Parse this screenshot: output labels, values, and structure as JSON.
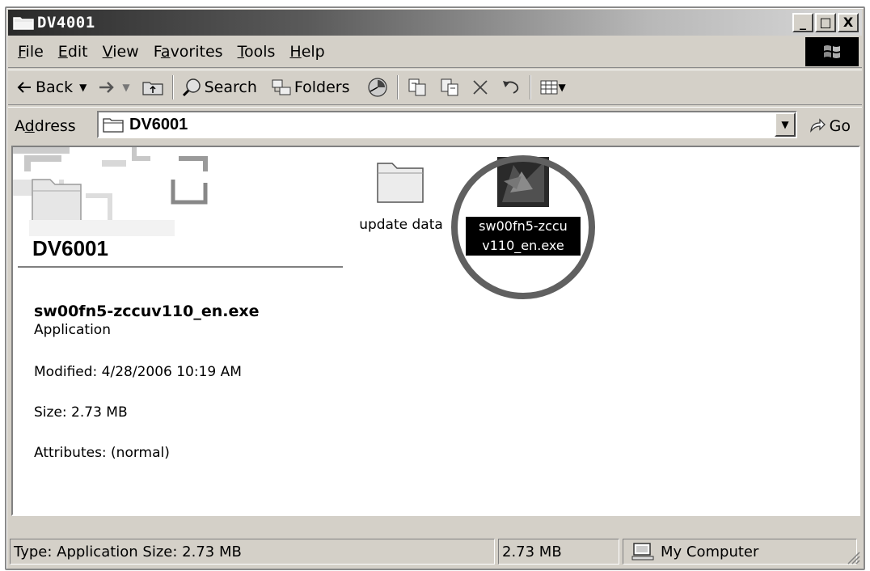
{
  "window": {
    "title": "DV4001",
    "minimize": "_",
    "maximize": "□",
    "close": "X"
  },
  "menu": {
    "items": [
      {
        "label": "File",
        "key": "F",
        "rest": "ile"
      },
      {
        "label": "Edit",
        "key": "E",
        "rest": "dit"
      },
      {
        "label": "View",
        "key": "V",
        "rest": "iew"
      },
      {
        "label": "Favorites",
        "pre": "F",
        "key": "a",
        "rest": "vorites"
      },
      {
        "label": "Tools",
        "key": "T",
        "rest": "ools"
      },
      {
        "label": "Help",
        "key": "H",
        "rest": "elp"
      }
    ]
  },
  "toolbar": {
    "back": "Back",
    "search": "Search",
    "folders": "Folders"
  },
  "address": {
    "label_pre": "A",
    "label_key": "d",
    "label_rest": "dress",
    "value": "DV6001",
    "go": "Go"
  },
  "panel": {
    "title": "DV6001",
    "file_name": "sw00fn5-zccuv110_en.exe",
    "file_type": "Application",
    "modified": "Modified: 4/28/2006 10:19 AM",
    "size": "Size: 2.73 MB",
    "attributes": "Attributes: (normal)"
  },
  "files": [
    {
      "name": "update data",
      "icon": "folder-icon"
    },
    {
      "name_line1": "sw00fn5-zccu",
      "name_line2": "v110_en.exe",
      "icon": "exe-icon",
      "selected": true
    }
  ],
  "status": {
    "info": "Type: Application Size: 2.73 MB",
    "size": "2.73 MB",
    "zone": "My Computer"
  },
  "colors": {
    "chrome": "#d4d0c8",
    "selection": "#000000",
    "highlight_circle": "#606060"
  }
}
